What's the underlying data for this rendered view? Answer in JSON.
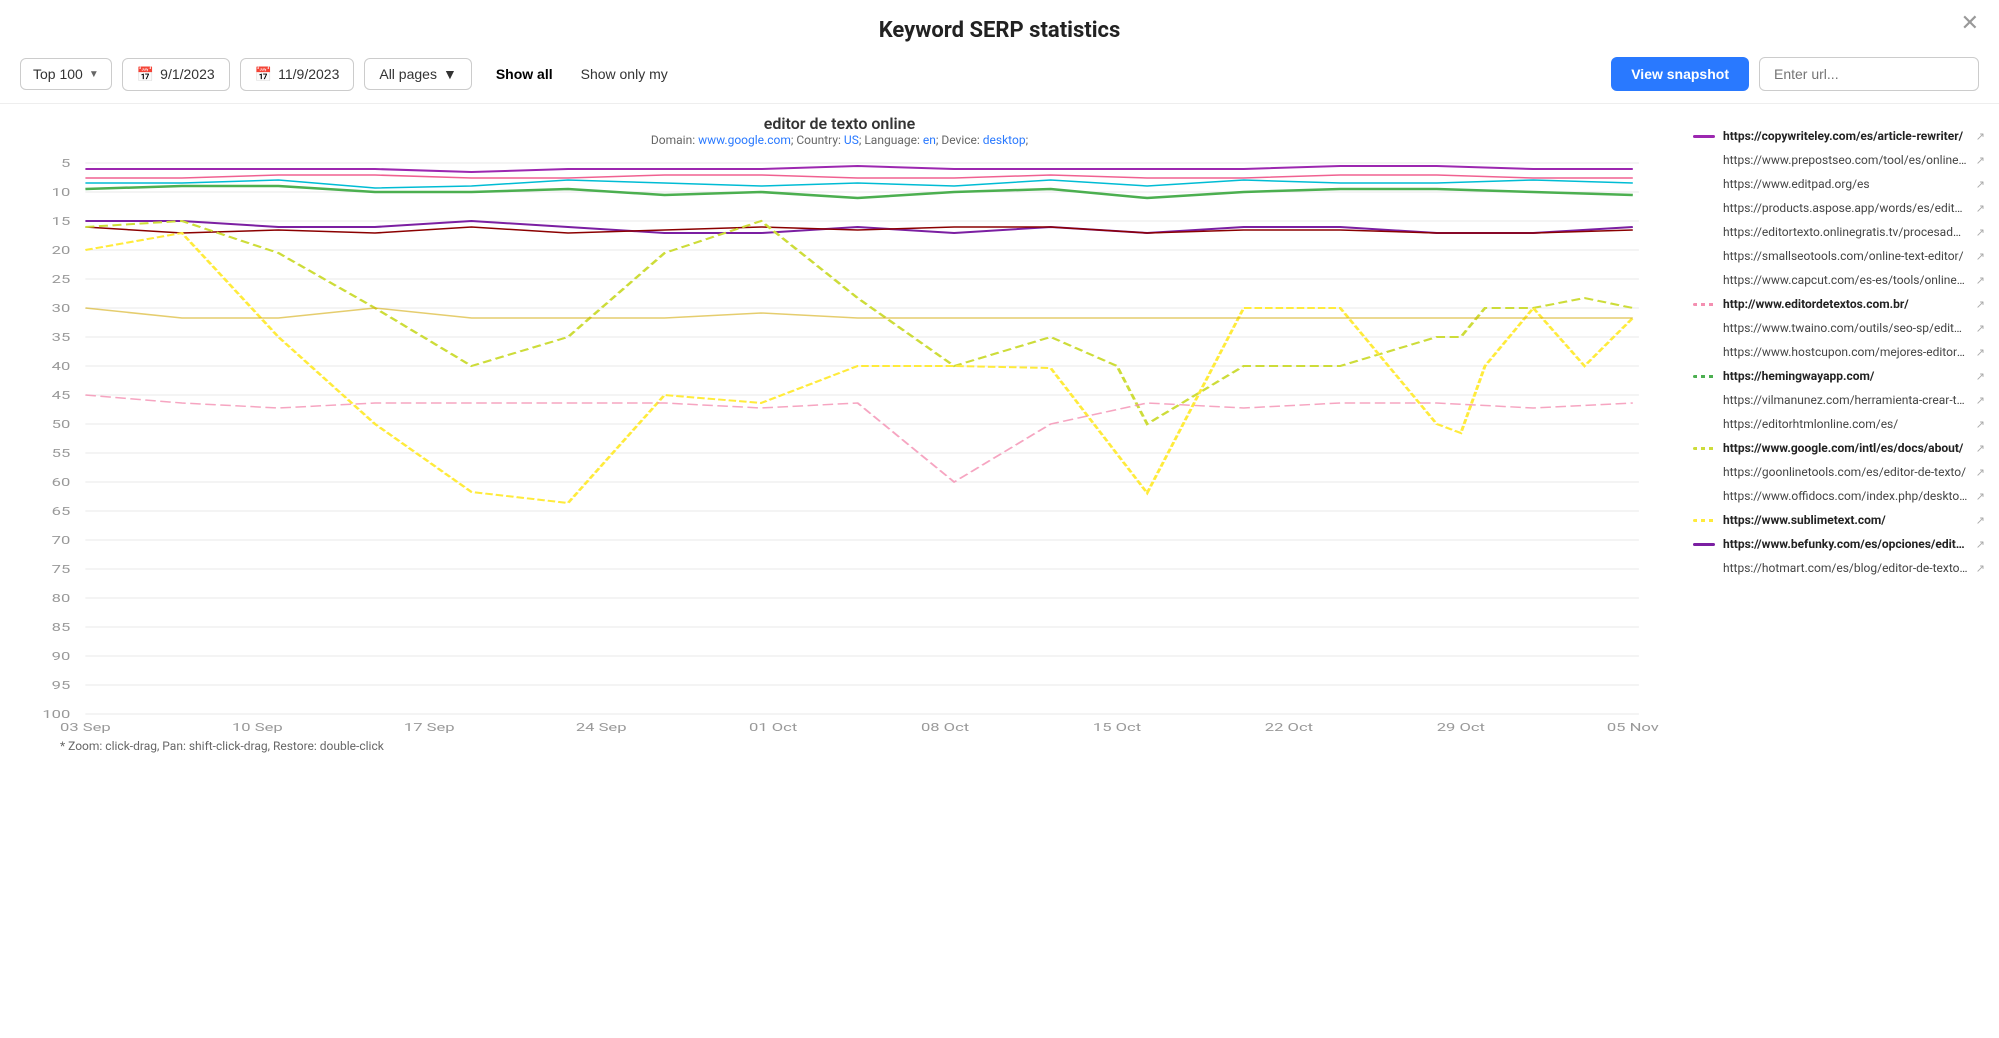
{
  "page": {
    "title": "Keyword SERP statistics",
    "close_label": "×"
  },
  "toolbar": {
    "top_filter": "Top 100",
    "date_start": "9/1/2023",
    "date_end": "11/9/2023",
    "pages_filter": "All pages",
    "show_all_label": "Show all",
    "show_only_my_label": "Show only my",
    "view_snapshot_label": "View snapshot",
    "url_search_placeholder": "Enter url..."
  },
  "chart": {
    "keyword": "editor de texto online",
    "meta": {
      "domain_label": "Domain:",
      "domain_value": "www.google.com",
      "country_label": "Country:",
      "country_value": "US",
      "language_label": "Language:",
      "language_value": "en",
      "device_label": "Device:",
      "device_value": "desktop"
    },
    "zoom_hint": "* Zoom: click-drag, Pan: shift-click-drag, Restore: double-click",
    "y_labels": [
      "5",
      "10",
      "15",
      "20",
      "25",
      "30",
      "35",
      "40",
      "45",
      "50",
      "55",
      "60",
      "65",
      "70",
      "75",
      "80",
      "85",
      "90",
      "95",
      "100"
    ],
    "x_labels": [
      "03 Sep",
      "10 Sep",
      "17 Sep",
      "24 Sep",
      "01 Oct",
      "08 Oct",
      "15 Oct",
      "22 Oct",
      "29 Oct",
      "05 Nov"
    ]
  },
  "legend": {
    "items": [
      {
        "url": "https://copywriteley.com/es/article-rewriter/",
        "color": "#9c27b0",
        "bold": true,
        "dashed": false
      },
      {
        "url": "https://www.prepostseo.com/tool/es/online-te...",
        "color": "#cccccc",
        "bold": false,
        "dashed": false
      },
      {
        "url": "https://www.editpad.org/es",
        "color": "#cccccc",
        "bold": false,
        "dashed": false
      },
      {
        "url": "https://products.aspose.app/words/es/editor/txt",
        "color": "#cccccc",
        "bold": false,
        "dashed": false
      },
      {
        "url": "https://editortexto.onlinegratis.tv/procesador/",
        "color": "#cccccc",
        "bold": false,
        "dashed": false
      },
      {
        "url": "https://smallseotools.com/online-text-editor/",
        "color": "#cccccc",
        "bold": false,
        "dashed": false
      },
      {
        "url": "https://www.capcut.com/es-es/tools/online-te...",
        "color": "#cccccc",
        "bold": false,
        "dashed": false
      },
      {
        "url": "http://www.editordetextos.com.br/",
        "color": "#f48fb1",
        "bold": true,
        "dashed": true
      },
      {
        "url": "https://www.twaino.com/outils/seo-sp/editor-...",
        "color": "#cccccc",
        "bold": false,
        "dashed": false
      },
      {
        "url": "https://www.hostcupon.com/mejores-editore...",
        "color": "#cccccc",
        "bold": false,
        "dashed": false
      },
      {
        "url": "https://hemingwayapp.com/",
        "color": "#4caf50",
        "bold": true,
        "dashed": true
      },
      {
        "url": "https://vilmanunez.com/herramienta-crear-te...",
        "color": "#cccccc",
        "bold": false,
        "dashed": false
      },
      {
        "url": "https://editorhtmlonline.com/es/",
        "color": "#cccccc",
        "bold": false,
        "dashed": false
      },
      {
        "url": "https://www.google.com/intl/es/docs/about/",
        "color": "#cddc39",
        "bold": true,
        "dashed": true
      },
      {
        "url": "https://goonlinetools.com/es/editor-de-texto/",
        "color": "#cccccc",
        "bold": false,
        "dashed": false
      },
      {
        "url": "https://www.offidocs.com/index.php/desktop-...",
        "color": "#cccccc",
        "bold": false,
        "dashed": false
      },
      {
        "url": "https://www.sublimetext.com/",
        "color": "#ffeb3b",
        "bold": true,
        "dashed": true
      },
      {
        "url": "https://www.befunky.com/es/opciones/editor-...",
        "color": "#7b1fa2",
        "bold": true,
        "dashed": false
      },
      {
        "url": "https://hotmart.com/es/blog/editor-de-texto...",
        "color": "#cccccc",
        "bold": false,
        "dashed": false
      }
    ]
  }
}
